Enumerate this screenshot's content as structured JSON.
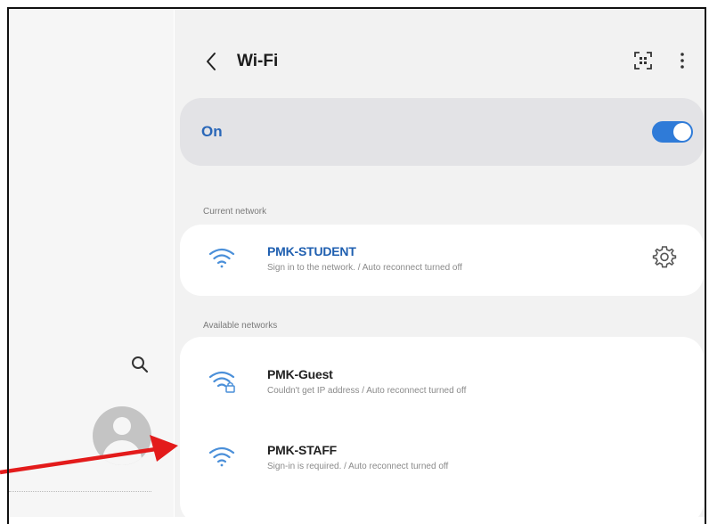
{
  "header": {
    "title": "Wi-Fi"
  },
  "wifi_toggle": {
    "label": "On",
    "state": "on"
  },
  "sections": {
    "current_label": "Current network",
    "available_label": "Available networks"
  },
  "current_network": {
    "name": "PMK-STUDENT",
    "status": "Sign in to the network. / Auto reconnect turned off"
  },
  "available_networks": [
    {
      "name": "PMK-Guest",
      "status": "Couldn't get IP address / Auto reconnect turned off",
      "secured": true
    },
    {
      "name": "PMK-STAFF",
      "status": "Sign-in is required. / Auto reconnect turned off",
      "secured": false
    }
  ],
  "icons": {
    "back": "chevron-left-icon",
    "qr": "qr-scan-icon",
    "more": "more-vertical-icon",
    "settings": "gear-icon",
    "search": "search-icon",
    "wifi": "wifi-icon"
  },
  "colors": {
    "accent": "#2f7bd8",
    "active_text": "#1f5fb0",
    "arrow": "#e31b1b"
  }
}
